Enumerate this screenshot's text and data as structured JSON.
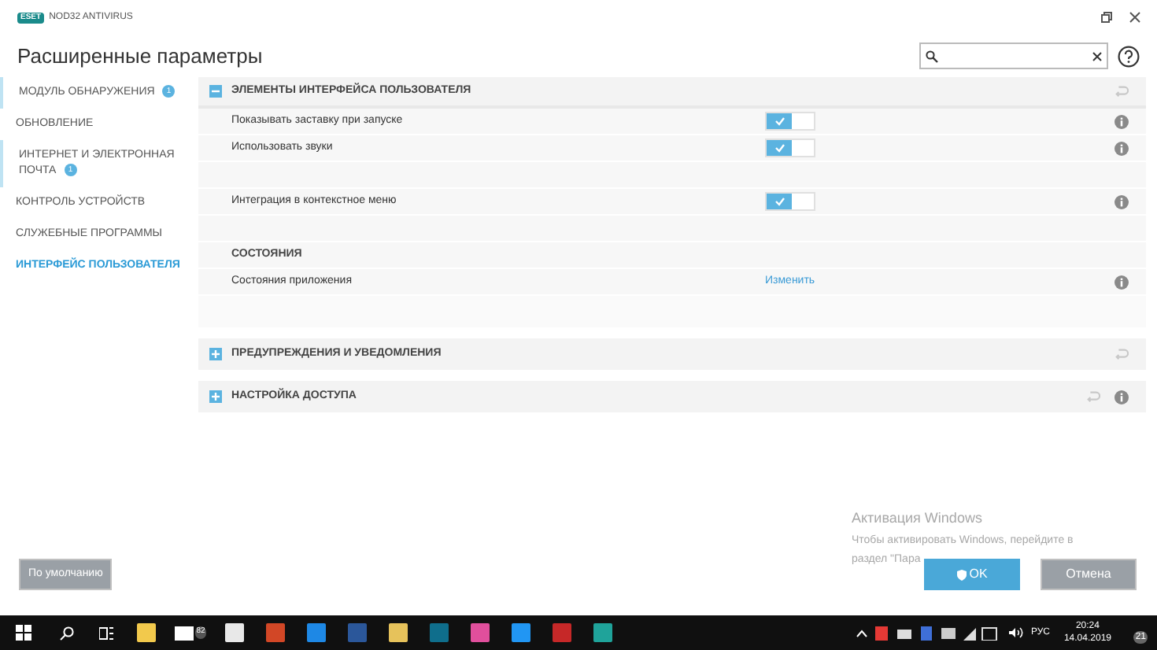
{
  "app": {
    "logo": "ESET",
    "name": "NOD32 ANTIVIRUS"
  },
  "title": "Расширенные параметры",
  "sidebar": [
    {
      "label": "МОДУЛЬ ОБНАРУЖЕНИЯ",
      "badge": "1",
      "selected": false
    },
    {
      "label": "ОБНОВЛЕНИЕ",
      "selected": false
    },
    {
      "label": "ИНТЕРНЕТ И ЭЛЕКТРОННАЯ ПОЧТА",
      "badge": "1",
      "selected": false
    },
    {
      "label": "КОНТРОЛЬ УСТРОЙСТВ",
      "selected": false
    },
    {
      "label": "СЛУЖЕБНЫЕ ПРОГРАММЫ",
      "selected": false
    },
    {
      "label": "ИНТЕРФЕЙС ПОЛЬЗОВАТЕЛЯ",
      "selected": true
    }
  ],
  "sections": [
    {
      "title": "ЭЛЕМЕНТЫ ИНТЕРФЕЙСА ПОЛЬЗОВАТЕЛЯ",
      "expanded": true,
      "info": false,
      "rows": [
        {
          "kind": "toggle",
          "label": "Показывать заставку при запуске",
          "on": true
        },
        {
          "kind": "toggle",
          "label": "Использовать звуки",
          "on": true
        },
        {
          "kind": "blank"
        },
        {
          "kind": "toggle",
          "label": "Интеграция в контекстное меню",
          "on": true
        },
        {
          "kind": "blank"
        },
        {
          "kind": "heading",
          "label": "СОСТОЯНИЯ"
        },
        {
          "kind": "link",
          "label": "Состояния приложения",
          "link": "Изменить"
        }
      ]
    },
    {
      "title": "ПРЕДУПРЕЖДЕНИЯ И УВЕДОМЛЕНИЯ",
      "expanded": false,
      "info": false
    },
    {
      "title": "НАСТРОЙКА ДОСТУПА",
      "expanded": false,
      "info": true
    }
  ],
  "buttons": {
    "default": "По умолчанию",
    "ok": "OK",
    "cancel": "Отмена"
  },
  "activation": {
    "title": "Активация Windows",
    "line1": "Чтобы активировать Windows, перейдите в",
    "line2": "раздел \"Пара"
  },
  "taskbar": {
    "mail_badge": "82",
    "language": "РУС",
    "time": "20:24",
    "date": "14.04.2019",
    "notifications": "21"
  }
}
